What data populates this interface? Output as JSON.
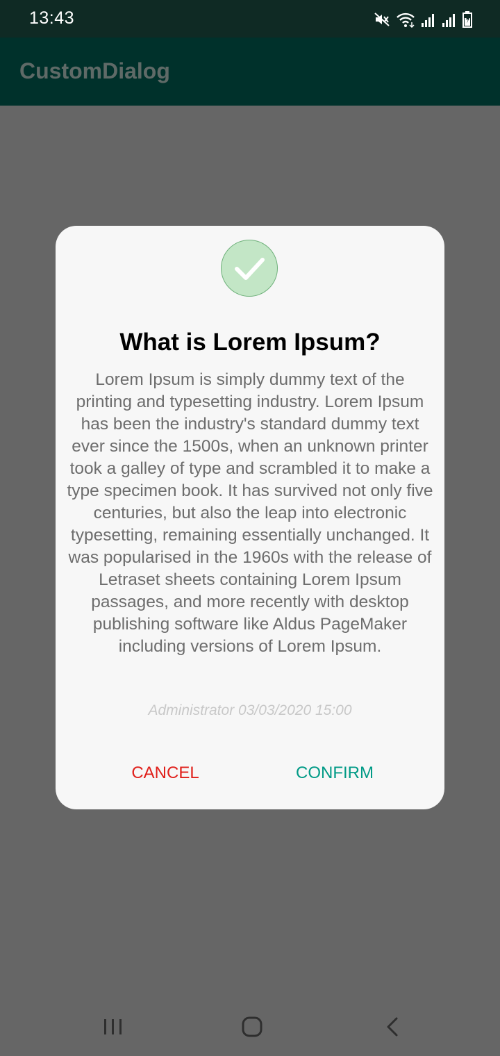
{
  "status_bar": {
    "time": "13:43",
    "icons": [
      "mute-icon",
      "wifi-icon",
      "signal-icon",
      "signal-icon",
      "battery-icon"
    ]
  },
  "app_bar": {
    "title": "CustomDialog"
  },
  "dialog": {
    "icon": "check-icon",
    "title": "What is Lorem Ipsum?",
    "body": "Lorem Ipsum is simply dummy text of the printing and typesetting industry. Lorem Ipsum has been the industry's standard dummy text ever since the 1500s, when an unknown printer took a galley of type and scrambled it to make a type specimen book. It has survived not only five centuries, but also the leap into electronic typesetting, remaining essentially unchanged. It was popularised in the 1960s with the release of Letraset sheets containing Lorem Ipsum passages, and more recently with desktop publishing software like Aldus PageMaker including versions of Lorem Ipsum.",
    "meta": "Administrator 03/03/2020 15:00",
    "cancel_label": "CANCEL",
    "confirm_label": "CONFIRM",
    "colors": {
      "cancel": "#e0201b",
      "confirm": "#009a86",
      "check_badge": "#c3e6c6"
    }
  },
  "nav_bar": {
    "buttons": [
      "recents-icon",
      "home-icon",
      "back-icon"
    ]
  }
}
